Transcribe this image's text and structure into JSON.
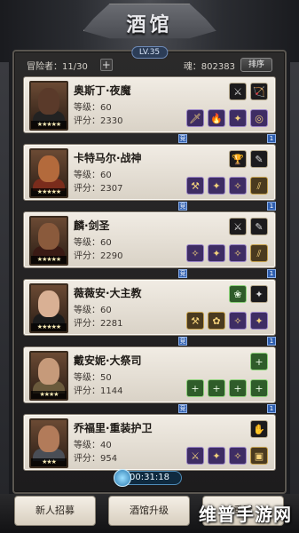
{
  "header": {
    "title": "酒馆",
    "level": "LV.35"
  },
  "stats": {
    "adventurers_label": "冒险者：11/30",
    "add_symbol": "+",
    "soul": "魂：802383",
    "sort_label": "排序"
  },
  "heroes": [
    {
      "name": "奥斯丁·夜魔",
      "level": "等级：60",
      "score": "评分：2330",
      "stars": "★★★★★",
      "face_color": "#5a3a2a",
      "body_color": "#222222",
      "slots_top": [
        "dark:⚔",
        "dark:🏹"
      ],
      "slots_bottom": [
        "purple:🗡",
        "purple:🔥",
        "purple:✦",
        "purple:◎"
      ]
    },
    {
      "name": "卡特马尔·战神",
      "level": "等级：60",
      "score": "评分：2307",
      "stars": "★★★★★",
      "face_color": "#b36a3c",
      "body_color": "#7a2c1c",
      "slots_top": [
        "dark:🏆",
        "dark:✎"
      ],
      "slots_bottom": [
        "purple:⚒",
        "purple:✦",
        "purple:✧",
        "brown:⫽"
      ]
    },
    {
      "name": "麟·剑圣",
      "level": "等级：60",
      "score": "评分：2290",
      "stars": "★★★★★",
      "face_color": "#8a5a3c",
      "body_color": "#3a1a14",
      "slots_top": [
        "dark:⚔",
        "dark:✎"
      ],
      "slots_bottom": [
        "purple:✧",
        "purple:✦",
        "purple:✧",
        "brown:⫽"
      ]
    },
    {
      "name": "薇薇安·大主教",
      "level": "等级：60",
      "score": "评分：2281",
      "stars": "★★★★★",
      "face_color": "#d9b094",
      "body_color": "#1c1c1c",
      "slots_top": [
        "green:❀",
        "dark:✦"
      ],
      "slots_bottom": [
        "brown:⚒",
        "brown:✿",
        "purple:✧",
        "purple:✦"
      ]
    },
    {
      "name": "戴安妮·大祭司",
      "level": "等级：50",
      "score": "评分：1144",
      "stars": "★★★★",
      "face_color": "#c69a7a",
      "body_color": "#6a5a3c",
      "slots_top": [
        "green:+"
      ],
      "slots_bottom": [
        "green:+",
        "green:+",
        "green:+",
        "green:+"
      ]
    },
    {
      "name": "乔福里·重装护卫",
      "level": "等级：40",
      "score": "评分：954",
      "stars": "★★★",
      "face_color": "#b27b5a",
      "body_color": "#4a4e56",
      "slots_top": [
        "dark:✋"
      ],
      "slots_bottom": [
        "purple:⚔",
        "purple:✦",
        "purple:✧",
        "brown:▣"
      ]
    }
  ],
  "connector_label": "竞",
  "connector_number": "1",
  "timer": "00:31:18",
  "bottom_buttons": [
    "新人招募",
    "酒馆升级",
    "重置"
  ],
  "watermark": "维普手游网"
}
